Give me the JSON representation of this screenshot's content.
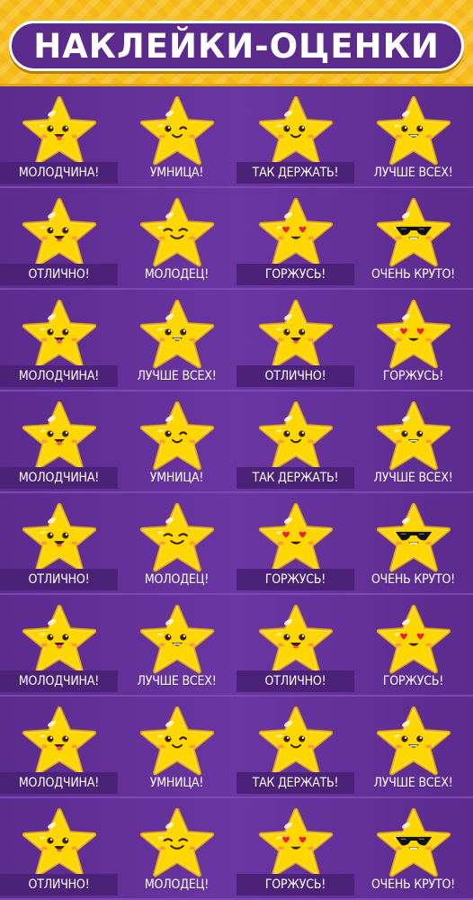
{
  "title": "НАКЛЕЙКИ-ОЦЕНКИ",
  "colors": {
    "background": "#5b2c8e",
    "header_yellow": "#f7bf1c",
    "title_pill": "#5a2a8c",
    "star_fill": "#ffd700",
    "star_outline": "#e9a900",
    "label_text": "#ffffff"
  },
  "rows": [
    {
      "stickers": [
        {
          "label": "МОЛОДЧИНА!",
          "face": "tongue"
        },
        {
          "label": "УМНИЦА!",
          "face": "wink"
        },
        {
          "label": "ТАК ДЕРЖАТЬ!",
          "face": "smile"
        },
        {
          "label": "ЛУЧШЕ ВСЕХ!",
          "face": "grin"
        }
      ]
    },
    {
      "stickers": [
        {
          "label": "ОТЛИЧНО!",
          "face": "open-smile"
        },
        {
          "label": "МОЛОДЕЦ!",
          "face": "content"
        },
        {
          "label": "ГОРЖУСЬ!",
          "face": "heart-eyes"
        },
        {
          "label": "ОЧЕНЬ КРУТО!",
          "face": "sunglasses"
        }
      ]
    },
    {
      "stickers": [
        {
          "label": "МОЛОДЧИНА!",
          "face": "tongue"
        },
        {
          "label": "ЛУЧШЕ ВСЕХ!",
          "face": "grin"
        },
        {
          "label": "ОТЛИЧНО!",
          "face": "open-smile"
        },
        {
          "label": "ГОРЖУСЬ!",
          "face": "heart-eyes"
        }
      ]
    },
    {
      "stickers": [
        {
          "label": "МОЛОДЧИНА!",
          "face": "tongue"
        },
        {
          "label": "УМНИЦА!",
          "face": "wink"
        },
        {
          "label": "ТАК ДЕРЖАТЬ!",
          "face": "smile"
        },
        {
          "label": "ЛУЧШЕ ВСЕХ!",
          "face": "grin"
        }
      ]
    },
    {
      "stickers": [
        {
          "label": "ОТЛИЧНО!",
          "face": "open-smile"
        },
        {
          "label": "МОЛОДЕЦ!",
          "face": "content"
        },
        {
          "label": "ГОРЖУСЬ!",
          "face": "heart-eyes"
        },
        {
          "label": "ОЧЕНЬ КРУТО!",
          "face": "sunglasses"
        }
      ]
    },
    {
      "stickers": [
        {
          "label": "МОЛОДЧИНА!",
          "face": "tongue"
        },
        {
          "label": "ЛУЧШЕ ВСЕХ!",
          "face": "grin"
        },
        {
          "label": "ОТЛИЧНО!",
          "face": "open-smile"
        },
        {
          "label": "ГОРЖУСЬ!",
          "face": "heart-eyes"
        }
      ]
    },
    {
      "stickers": [
        {
          "label": "МОЛОДЧИНА!",
          "face": "tongue"
        },
        {
          "label": "УМНИЦА!",
          "face": "wink"
        },
        {
          "label": "ТАК ДЕРЖАТЬ!",
          "face": "smile"
        },
        {
          "label": "ЛУЧШЕ ВСЕХ!",
          "face": "grin"
        }
      ]
    },
    {
      "stickers": [
        {
          "label": "ОТЛИЧНО!",
          "face": "open-smile"
        },
        {
          "label": "МОЛОДЕЦ!",
          "face": "content"
        },
        {
          "label": "ГОРЖУСЬ!",
          "face": "heart-eyes"
        },
        {
          "label": "ОЧЕНЬ КРУТО!",
          "face": "sunglasses"
        }
      ]
    }
  ]
}
